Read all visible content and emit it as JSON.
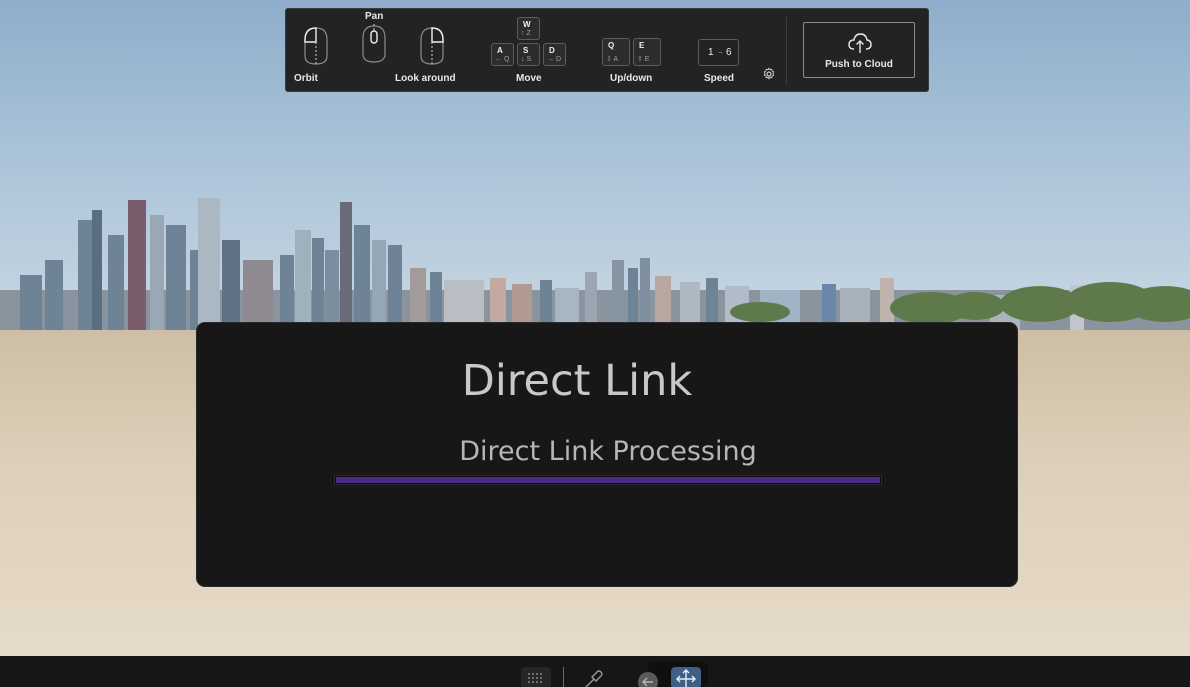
{
  "controls": {
    "orbit_label": "Orbit",
    "pan_label": "Pan",
    "look_label": "Look around",
    "move_label": "Move",
    "updown_label": "Up/down",
    "speed_label": "Speed",
    "keys": {
      "w": {
        "key": "W",
        "sub": "↑ Z"
      },
      "a": {
        "key": "A",
        "sub": "← Q"
      },
      "s": {
        "key": "S",
        "sub": "↓ S"
      },
      "d": {
        "key": "D",
        "sub": "→ D"
      },
      "q": {
        "key": "Q",
        "sub": "⇩ A"
      },
      "e": {
        "key": "E",
        "sub": "⇧ E"
      }
    },
    "speed_from": "1",
    "speed_to": "6",
    "push_label": "Push to Cloud",
    "icons": [
      "mouse-left-icon",
      "mouse-middle-icon",
      "mouse-right-icon",
      "gear-icon",
      "cloud-upload-icon"
    ]
  },
  "panel": {
    "title": "Direct Link",
    "status": "Direct Link Processing",
    "progress": 1.0,
    "progress_color": "#4b2a88"
  },
  "bottom_toolbar": {
    "icons": [
      "grid-icon",
      "eyedropper-icon",
      "back-arrow-icon",
      "move-icon"
    ],
    "active_color": "#3f5f86"
  }
}
